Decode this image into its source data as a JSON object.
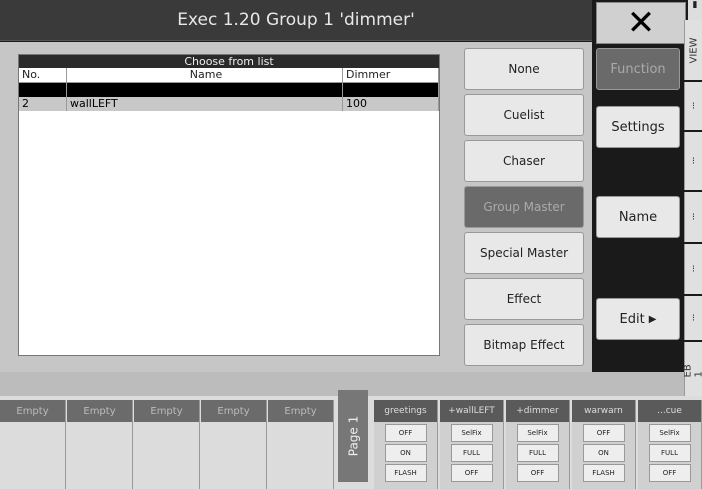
{
  "title": "Exec 1.20 Group 1 'dimmer'",
  "close_label": "✕",
  "top_icon": "▮",
  "list": {
    "header": "Choose from list",
    "columns": [
      "No.",
      "Name",
      "Dimmer"
    ],
    "rows": [
      {
        "no": "",
        "name": "",
        "dimmer": ""
      },
      {
        "no": "2",
        "name": "wallLEFT",
        "dimmer": "100"
      }
    ]
  },
  "side_buttons": [
    "None",
    "Cuelist",
    "Chaser",
    "Group Master",
    "Special Master",
    "Effect",
    "Bitmap Effect"
  ],
  "right_buttons": {
    "function": "Function",
    "settings": "Settings",
    "name": "Name",
    "edit": "Edit"
  },
  "edge_tabs": [
    "VIEW",
    "EB 1"
  ],
  "bottom": {
    "empties": [
      "Empty",
      "Empty",
      "Empty",
      "Empty",
      "Empty"
    ],
    "page_label": "Page 1",
    "faders": [
      {
        "label": "greetings",
        "b1": "OFF",
        "b2": "ON",
        "b3": "FLASH"
      },
      {
        "label": "+wallLEFT",
        "b1": "SelFix",
        "b2": "FULL",
        "b3": "OFF"
      },
      {
        "label": "+dimmer",
        "b1": "SelFix",
        "b2": "FULL",
        "b3": "OFF"
      },
      {
        "label": "warwarn",
        "b1": "OFF",
        "b2": "ON",
        "b3": "FLASH"
      },
      {
        "label": "...cue",
        "b1": "SelFix",
        "b2": "FULL",
        "b3": "OFF"
      }
    ]
  }
}
